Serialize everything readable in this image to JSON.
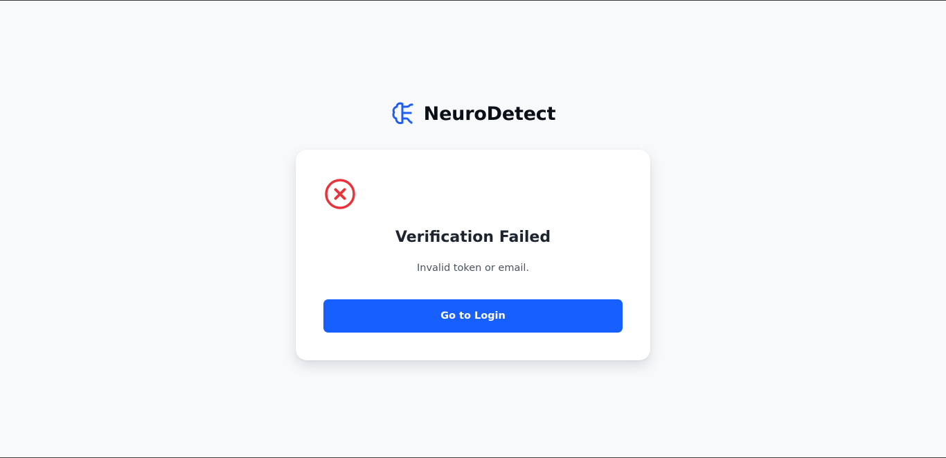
{
  "brand": {
    "name": "NeuroDetect",
    "icon": "brain-icon",
    "color": "#1f5ef0"
  },
  "card": {
    "status_icon": "x-circle-icon",
    "status_color": "#e8333a",
    "title": "Verification Failed",
    "message": "Invalid token or email.",
    "button_label": "Go to Login",
    "button_color": "#175ffe"
  }
}
